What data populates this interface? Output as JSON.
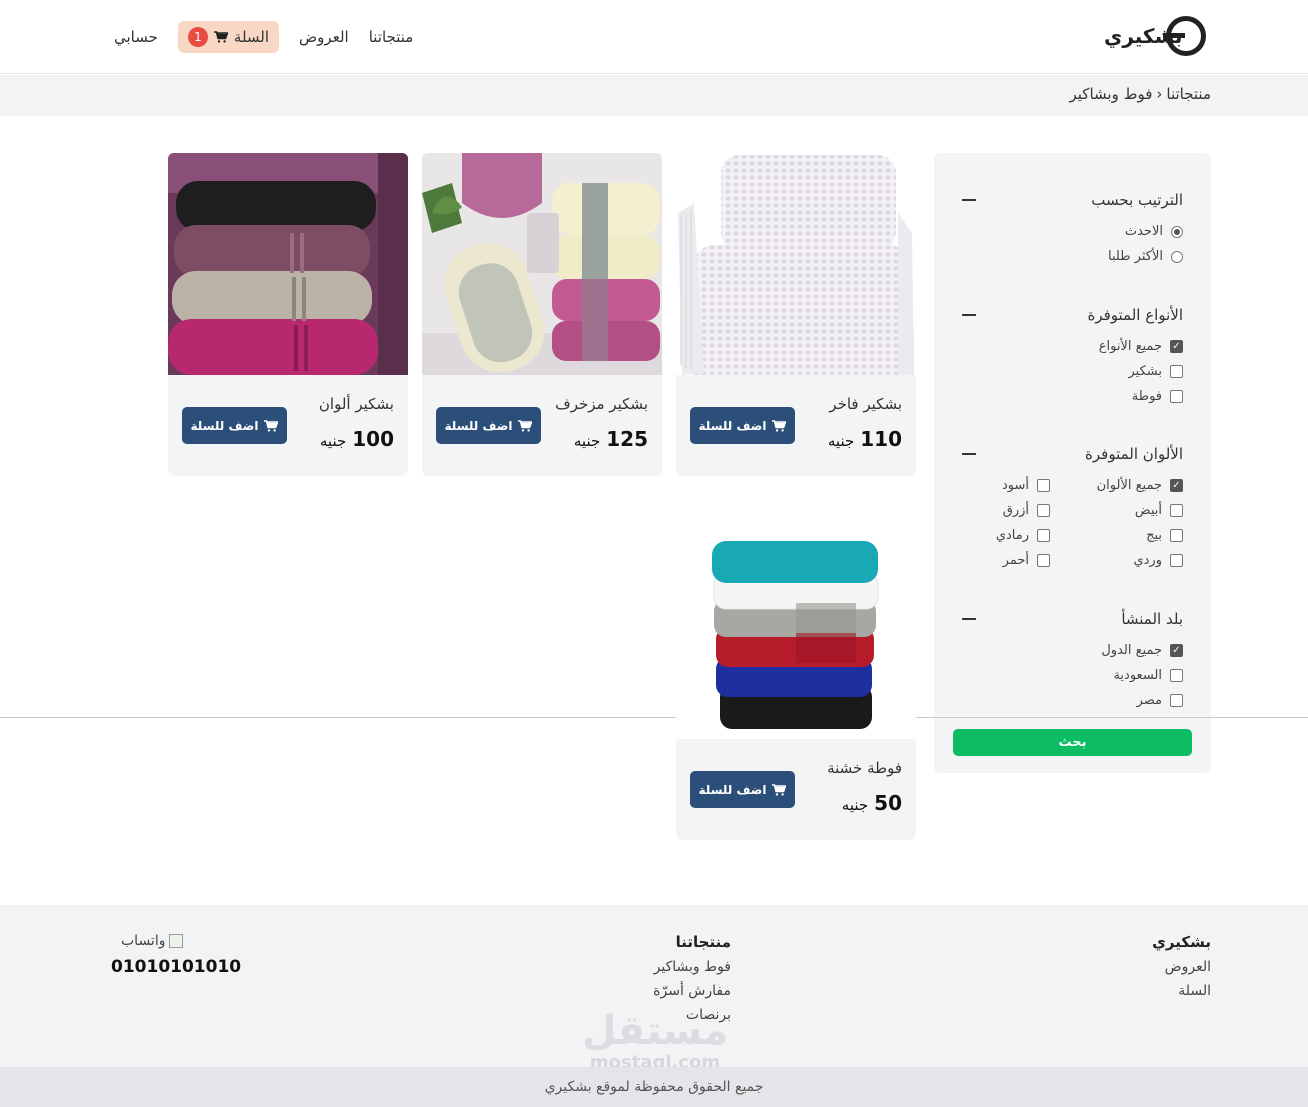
{
  "header": {
    "logo_text": "بشكيري",
    "nav": {
      "products": "منتجاتنا",
      "offers": "العروض",
      "cart_label": "السلة",
      "cart_count": "1",
      "account": "حسابي"
    }
  },
  "breadcrumb": {
    "root": "منتجاتنا",
    "separator": "›",
    "current": "فوط وبشاكير"
  },
  "filters": {
    "sort": {
      "title": "الترتيب بحسب",
      "options": [
        {
          "label": "الاحدث",
          "selected": true
        },
        {
          "label": "الأكثر طلبا",
          "selected": false
        }
      ]
    },
    "types": {
      "title": "الأنواع المتوفرة",
      "options": [
        {
          "label": "جميع الأنواع",
          "checked": true
        },
        {
          "label": "بشكير",
          "checked": false
        },
        {
          "label": "فوطة",
          "checked": false
        }
      ]
    },
    "colors": {
      "title": "الألوان المتوفرة",
      "options": [
        {
          "label": "جميع الألوان",
          "checked": true
        },
        {
          "label": "أسود",
          "checked": false
        },
        {
          "label": "أبيض",
          "checked": false
        },
        {
          "label": "أزرق",
          "checked": false
        },
        {
          "label": "بيج",
          "checked": false
        },
        {
          "label": "رمادي",
          "checked": false
        },
        {
          "label": "وردي",
          "checked": false
        },
        {
          "label": "أحمر",
          "checked": false
        }
      ]
    },
    "origin": {
      "title": "بلد المنشأ",
      "options": [
        {
          "label": "جميع الدول",
          "checked": true
        },
        {
          "label": "السعودية",
          "checked": false
        },
        {
          "label": "مصر",
          "checked": false
        }
      ]
    },
    "search_label": "بحث"
  },
  "products": [
    {
      "name": "بشكير فاخر",
      "price": "110",
      "currency": "جنيه",
      "button": "اضف للسلة",
      "image": "white-waffle-towels"
    },
    {
      "name": "بشكير مزخرف",
      "price": "125",
      "currency": "جنيه",
      "button": "اضف للسلة",
      "image": "patterned-pink-cream-towels"
    },
    {
      "name": "بشكير ألوان",
      "price": "100",
      "currency": "جنيه",
      "button": "اضف للسلة",
      "image": "rolled-colored-towels"
    },
    {
      "name": "فوطة خشنة",
      "price": "50",
      "currency": "جنيه",
      "button": "اضف للسلة",
      "image": "stacked-multicolor-towels"
    }
  ],
  "footer": {
    "brand_col": {
      "title": "بشكيري",
      "links": [
        "العروض",
        "السلة"
      ]
    },
    "products_col": {
      "title": "منتجاتنا",
      "links": [
        "فوط وبشاكير",
        "مفارش أسرّة",
        "برنصات"
      ]
    },
    "contact": {
      "whatsapp_alt": "واتساب",
      "phone": "01010101010"
    },
    "copyright": "جميع الحقوق محفوظة لموقع بشكيري",
    "watermark_main": "مستقل",
    "watermark_sub": "mostaql.com"
  },
  "colors": {
    "primary_button": "#2c4f7a",
    "search_button": "#0dbd63",
    "cart_pill": "#f8d8c5",
    "cart_badge": "#ea4b43",
    "panel_bg": "#f3f4f6"
  }
}
